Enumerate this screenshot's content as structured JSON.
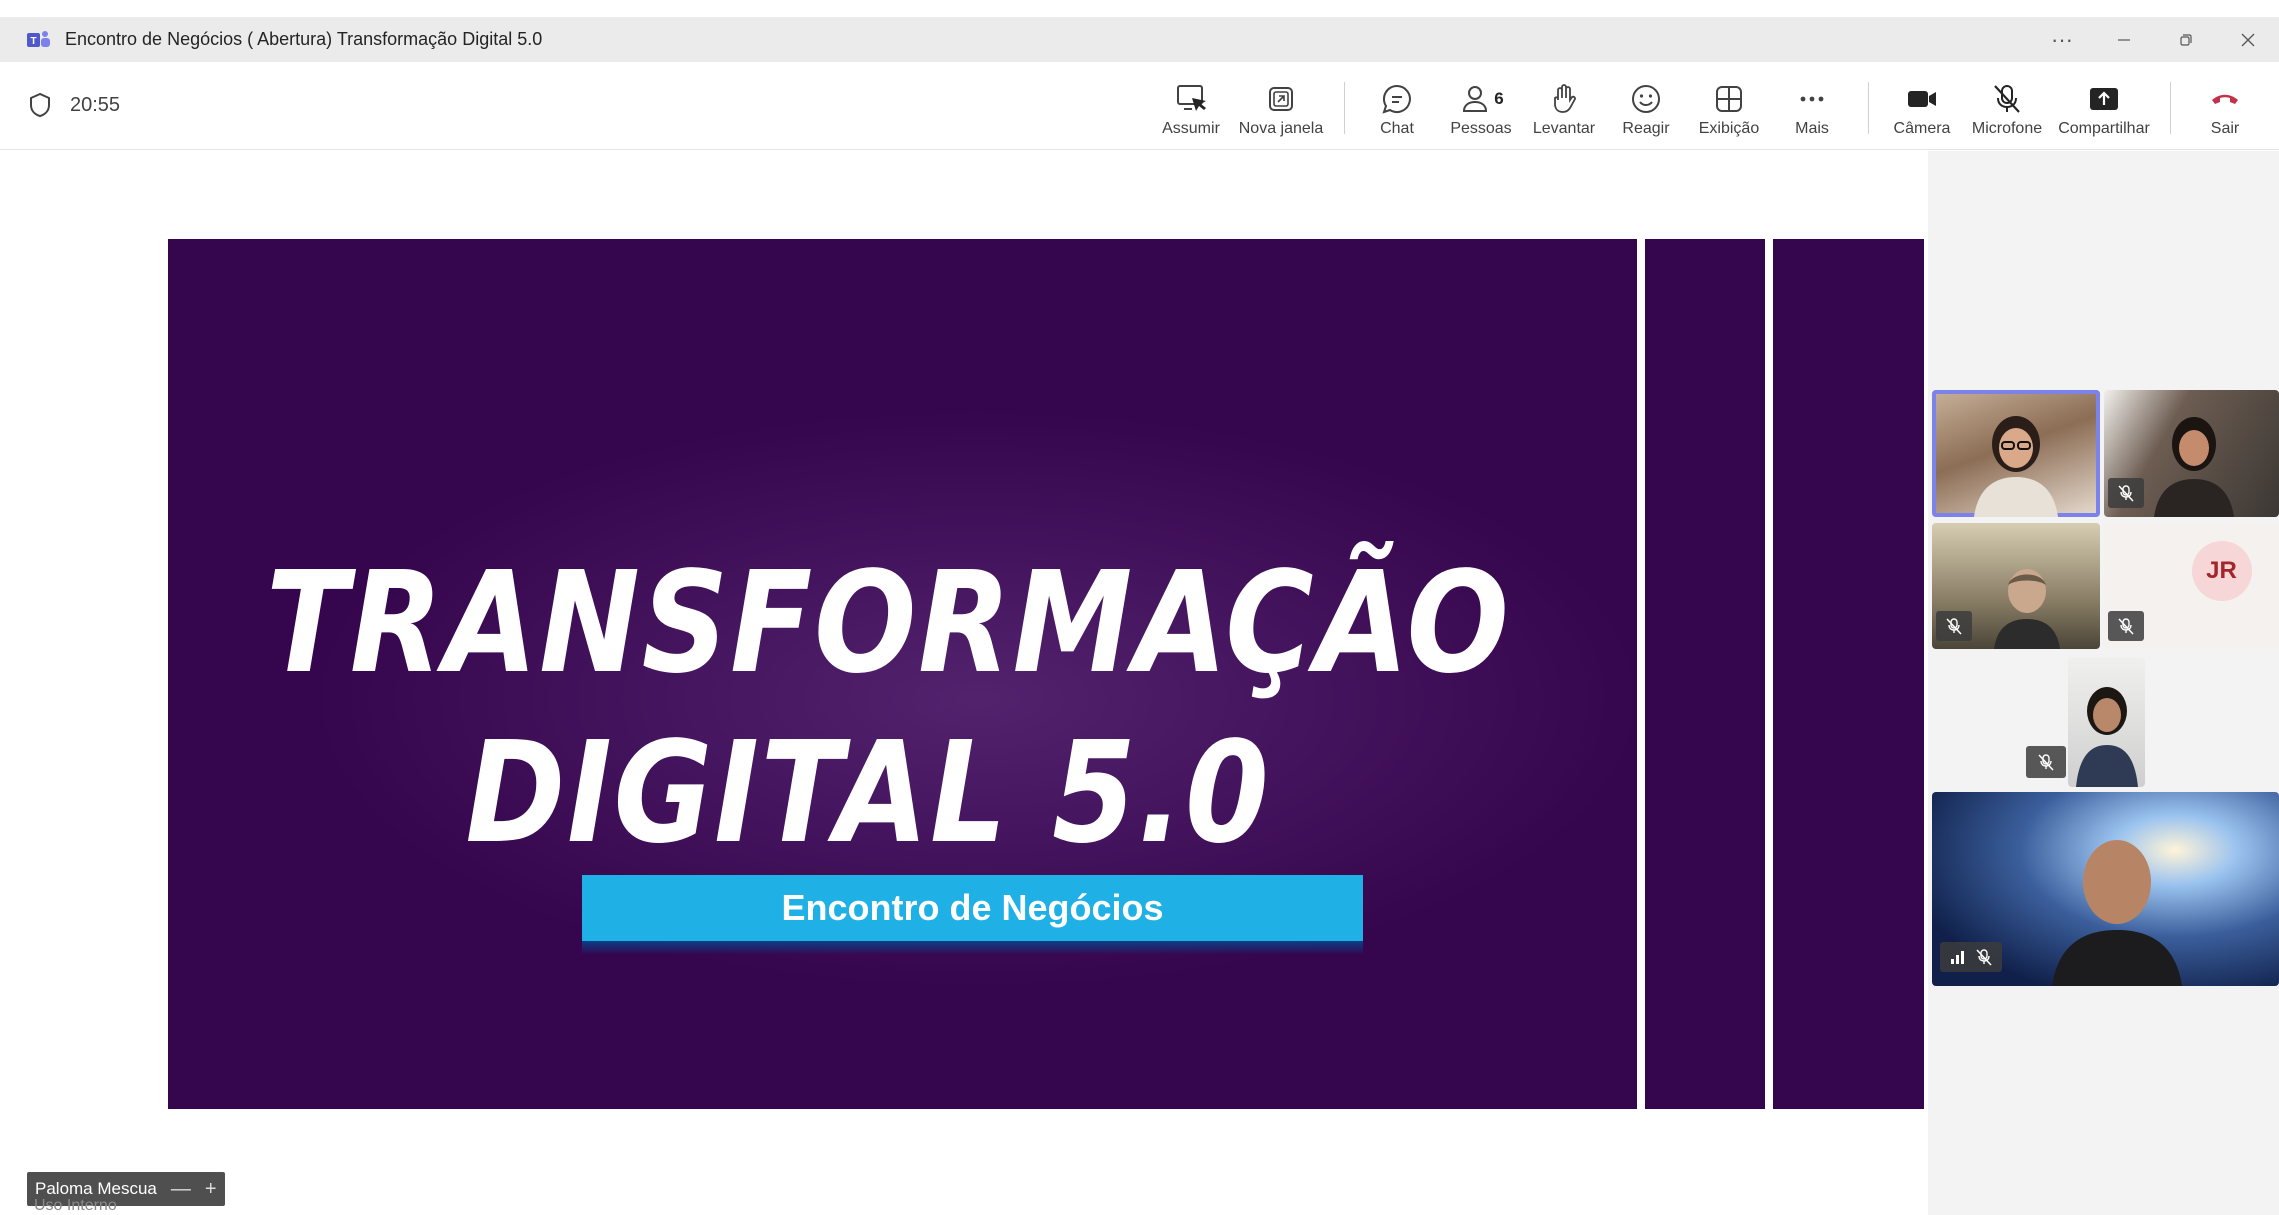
{
  "window": {
    "title": "Encontro de Negócios ( Abertura) Transformação Digital 5.0",
    "more_label": "···"
  },
  "toolbar": {
    "timer": "20:55",
    "buttons": [
      {
        "id": "assumir",
        "label": "Assumir",
        "icon": "take-control-icon"
      },
      {
        "id": "nova-janela",
        "label": "Nova janela",
        "icon": "pop-out-icon"
      },
      {
        "id": "chat",
        "label": "Chat",
        "icon": "chat-icon"
      },
      {
        "id": "pessoas",
        "label": "Pessoas",
        "icon": "people-icon",
        "count": "6"
      },
      {
        "id": "levantar",
        "label": "Levantar",
        "icon": "raise-hand-icon"
      },
      {
        "id": "reagir",
        "label": "Reagir",
        "icon": "react-icon"
      },
      {
        "id": "exibicao",
        "label": "Exibição",
        "icon": "view-icon"
      },
      {
        "id": "mais",
        "label": "Mais",
        "icon": "more-icon"
      },
      {
        "id": "camera",
        "label": "Câmera",
        "icon": "camera-icon"
      },
      {
        "id": "microfone",
        "label": "Microfone",
        "icon": "mic-off-icon"
      },
      {
        "id": "compartilhar",
        "label": "Compartilhar",
        "icon": "share-icon"
      },
      {
        "id": "sair",
        "label": "Sair",
        "icon": "leave-icon"
      }
    ]
  },
  "slide": {
    "headline_line1": "TRANSFORMAÇÃO",
    "headline_line2": "DIGITAL 5.0",
    "banner": "Encontro de Negócios"
  },
  "presenter": {
    "name": "Paloma Mescua",
    "watermark": "Uso Interno"
  },
  "participants": [
    {
      "id": "p1",
      "type": "video",
      "muted": false,
      "active": true
    },
    {
      "id": "p2",
      "type": "video",
      "muted": true
    },
    {
      "id": "p3",
      "type": "video",
      "muted": true
    },
    {
      "id": "p4",
      "type": "initials",
      "initials": "JR",
      "muted": true
    },
    {
      "id": "p5",
      "type": "video",
      "muted": true
    },
    {
      "id": "p6",
      "type": "video",
      "muted": true
    }
  ],
  "colors": {
    "slide_background": "#35054d",
    "banner": "#1fb0e6",
    "leave": "#c4314b",
    "active_speaker": "#7b83eb"
  }
}
